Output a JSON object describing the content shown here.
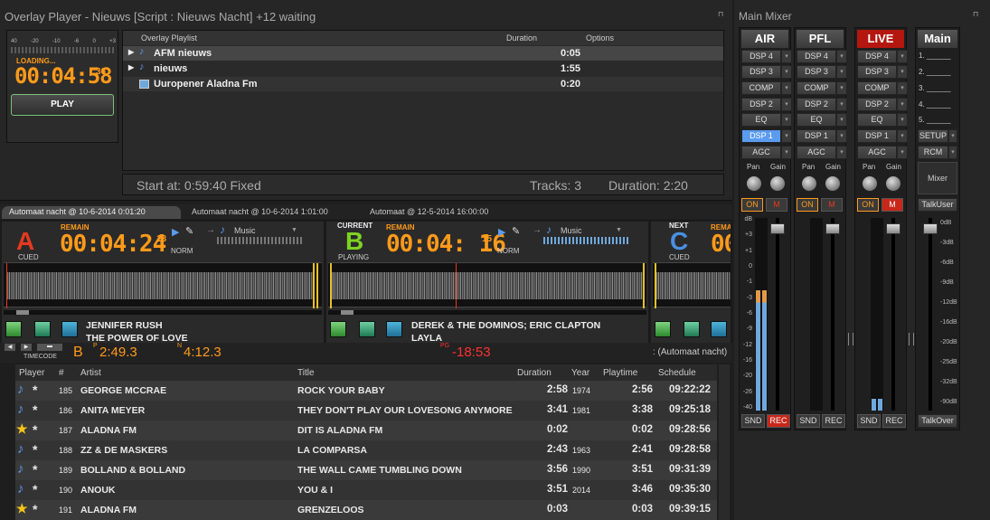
{
  "overlay": {
    "title": "Overlay Player - Nieuws [Script : Nieuws Nacht] +12 waiting",
    "loading": "LOADING...",
    "time": "00:04:58",
    "frames": "36",
    "play": "PLAY",
    "vu_scale": [
      "40",
      "-20",
      "-10",
      "-6",
      "0",
      "+3"
    ],
    "cols": {
      "playlist": "Overlay Playlist",
      "duration": "Duration",
      "options": "Options"
    },
    "items": [
      {
        "name": "AFM nieuws",
        "dur": "0:05"
      },
      {
        "name": "nieuws",
        "dur": "1:55"
      },
      {
        "name": "Uuropener Aladna Fm",
        "dur": "0:20"
      }
    ],
    "start_label": "Start at: 0:59:40 Fixed",
    "tracks": "Tracks: 3",
    "duration": "Duration: 2:20"
  },
  "tabs": [
    "Automaat nacht @ 10-6-2014 0:01:20",
    "Automaat nacht @ 10-6-2014 1:01:00",
    "Automaat @ 12-5-2014 16:00:00"
  ],
  "decks": {
    "a": {
      "letter": "A",
      "state": "CUED",
      "header": "REMAIN",
      "time": "00:04:24",
      "frames": "13",
      "genre": "Music",
      "norm": "NORM",
      "artist": "JENNIFER RUSH",
      "title": "THE POWER OF LOVE"
    },
    "b": {
      "letter": "B",
      "state": "PLAYING",
      "current": "CURRENT",
      "header": "REMAIN",
      "time": "00:04: 16",
      "frames": "15",
      "genre": "Music",
      "norm": "NORM",
      "artist": "DEREK & THE DOMINOS; ERIC CLAPTON",
      "title": "LAYLA"
    },
    "c": {
      "letter": "C",
      "state": "CUED",
      "next": "NEXT",
      "header": "REMA"
    }
  },
  "timecode": {
    "label": "TIMECODE",
    "deck": "B",
    "p_label": "P",
    "p_time": "2:49.3",
    "n_label": "N",
    "n_time": "4:12.3",
    "pg_label": "PG",
    "pg_time": "-18:53",
    "script": ": (Automaat nacht)"
  },
  "table": {
    "cols": [
      "Player",
      "#",
      "Artist",
      "Title",
      "Duration",
      "Year",
      "Playtime",
      "Schedule"
    ],
    "rows": [
      {
        "icon": "note",
        "n": "185",
        "artist": "GEORGE MCCRAE",
        "title": "ROCK YOUR BABY",
        "dur": "2:58",
        "year": "1974",
        "play": "2:56",
        "sched": "09:22:22"
      },
      {
        "icon": "note",
        "n": "186",
        "artist": "ANITA MEYER",
        "title": "THEY DON'T PLAY OUR LOVESONG ANYMORE",
        "dur": "3:41",
        "year": "1981",
        "play": "3:38",
        "sched": "09:25:18"
      },
      {
        "icon": "star",
        "n": "187",
        "artist": "ALADNA FM",
        "title": "DIT IS ALADNA FM",
        "dur": "0:02",
        "year": "",
        "play": "0:02",
        "sched": "09:28:56"
      },
      {
        "icon": "note",
        "n": "188",
        "artist": "ZZ & DE MASKERS",
        "title": "LA COMPARSA",
        "dur": "2:43",
        "year": "1963",
        "play": "2:41",
        "sched": "09:28:58"
      },
      {
        "icon": "note",
        "n": "189",
        "artist": "BOLLAND & BOLLAND",
        "title": "THE WALL CAME TUMBLING DOWN",
        "dur": "3:56",
        "year": "1990",
        "play": "3:51",
        "sched": "09:31:39"
      },
      {
        "icon": "note",
        "n": "190",
        "artist": "ANOUK",
        "title": "YOU & I",
        "dur": "3:51",
        "year": "2014",
        "play": "3:46",
        "sched": "09:35:30"
      },
      {
        "icon": "star",
        "n": "191",
        "artist": "ALADNA FM",
        "title": "GRENZELOOS",
        "dur": "0:03",
        "year": "",
        "play": "0:03",
        "sched": "09:39:15"
      }
    ]
  },
  "mixer": {
    "title": "Main Mixer",
    "channels": [
      {
        "name": "AIR"
      },
      {
        "name": "PFL"
      },
      {
        "name": "LIVE"
      }
    ],
    "dsp": [
      "DSP 4",
      "DSP 3",
      "COMP",
      "DSP 2",
      "EQ",
      "DSP 1",
      "AGC"
    ],
    "pan": "Pan",
    "gain": "Gain",
    "on": "ON",
    "m": "M",
    "snd": "SND",
    "rec": "REC",
    "scale": [
      "dB",
      "+3",
      "+1",
      "0",
      "-1",
      "-3",
      "-6",
      "-9",
      "-12",
      "-16",
      "-20",
      "-26",
      "-40"
    ],
    "main": {
      "name": "Main",
      "slots": [
        "1. ______",
        "2. ______",
        "3. ______",
        "4. ______",
        "5. ______"
      ],
      "setup": "SETUP",
      "rcm": "RCM",
      "mixer": "Mixer",
      "talkuser": "TalkUser",
      "talkover": "TalkOver",
      "scale": [
        "0dB",
        "-3dB",
        "-6dB",
        "-9dB",
        "-12dB",
        "-16dB",
        "-20dB",
        "-25dB",
        "-32dB",
        "-90dB"
      ]
    }
  },
  "colors": {
    "accent": "#ff9a1a",
    "deck_a": "#e5391f",
    "deck_b": "#7ed321",
    "deck_c": "#4a90e2",
    "live": "#b3170f"
  }
}
